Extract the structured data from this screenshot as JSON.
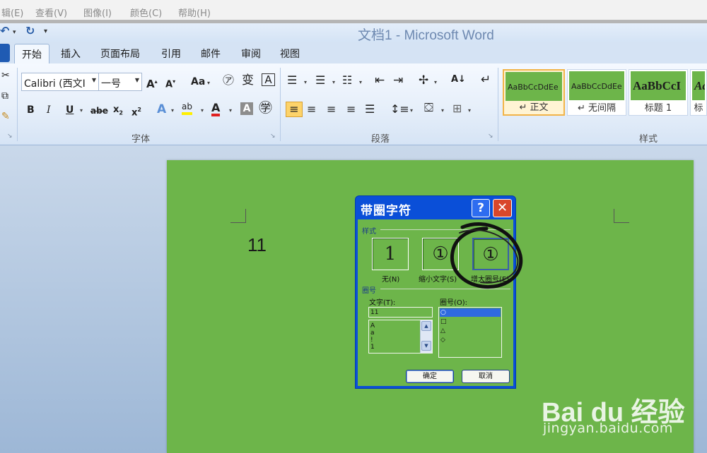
{
  "host_menu": [
    "辑(E)",
    "查看(V)",
    "图像(I)",
    "颜色(C)",
    "帮助(H)"
  ],
  "window": {
    "title": "文档1 - Microsoft Word"
  },
  "tabs": [
    "开始",
    "插入",
    "页面布局",
    "引用",
    "邮件",
    "审阅",
    "视图"
  ],
  "ribbon": {
    "font_name": "Calibri (西文I",
    "font_size": "一号",
    "groups": {
      "font": "字体",
      "paragraph": "段落",
      "styles": "样式"
    },
    "styles": [
      {
        "preview": "AaBbCcDdEe",
        "name": "↵ 正文"
      },
      {
        "preview": "AaBbCcDdEe",
        "name": "↵ 无间隔"
      },
      {
        "preview": "AaBbCcI",
        "name": "标题 1"
      },
      {
        "preview": "Aa",
        "name": "标"
      }
    ]
  },
  "document": {
    "text": "11"
  },
  "dialog": {
    "title": "带圈字符",
    "help": "?",
    "close": "✕",
    "style_section": "样式",
    "options": [
      {
        "glyph": "1",
        "label": "无(N)"
      },
      {
        "glyph": "①",
        "label": "缩小文字(S)"
      },
      {
        "glyph": "①",
        "label": "增大圈号(E)"
      }
    ],
    "enclosure_section": "圈号",
    "text_label": "文字(T):",
    "text_value": "11",
    "text_list": [
      "A",
      "a",
      "!",
      "1"
    ],
    "enclosure_label": "圈号(O):",
    "enclosure_list": [
      "○",
      "□",
      "△",
      "◇"
    ],
    "ok": "确定",
    "cancel": "取消"
  },
  "watermark": {
    "brand": "Bai du 经验",
    "url": "jingyan.baidu.com"
  }
}
